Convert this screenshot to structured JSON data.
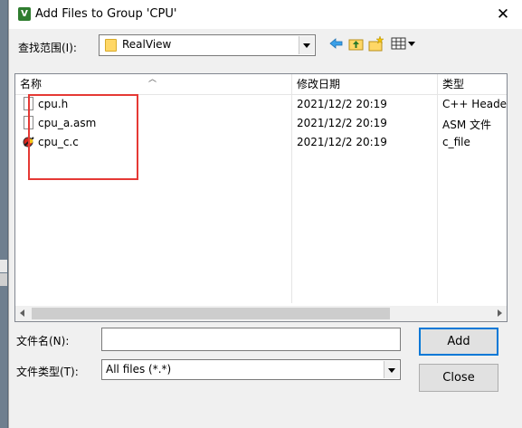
{
  "window": {
    "title": "Add Files to Group 'CPU'",
    "close_glyph": "✕"
  },
  "lookin": {
    "label": "查找范围(I):",
    "value": "RealView"
  },
  "columns": [
    "名称",
    "修改日期",
    "类型"
  ],
  "files": [
    {
      "name": "cpu.h",
      "date": "2021/12/2 20:19",
      "type": "C++ Heade",
      "icon": "document-icon"
    },
    {
      "name": "cpu_a.asm",
      "date": "2021/12/2 20:19",
      "type": "ASM 文件",
      "icon": "document-icon"
    },
    {
      "name": "cpu_c.c",
      "date": "2021/12/2 20:19",
      "type": "c_file",
      "icon": "c-source-icon"
    }
  ],
  "filename": {
    "label": "文件名(N):",
    "value": "",
    "placeholder": ""
  },
  "filetype": {
    "label": "文件类型(T):",
    "value": "All files (*.*)"
  },
  "buttons": {
    "add": "Add",
    "close": "Close"
  },
  "colors": {
    "highlight_box": "#e53935",
    "folder": "#ffd766",
    "default_button_border": "#0078d7"
  }
}
